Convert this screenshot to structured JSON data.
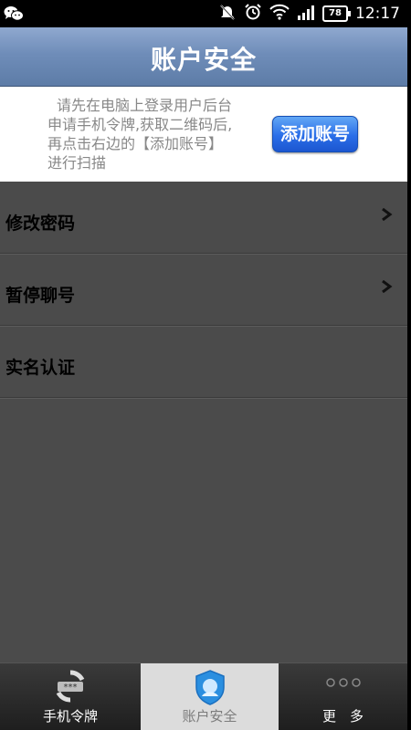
{
  "status": {
    "battery": "78",
    "time": "12:17"
  },
  "header": {
    "title": "账户安全"
  },
  "notice": {
    "line1": "请先在电脑上登录用户后台",
    "line2": "申请手机令牌,获取二维码后,",
    "line3": "再点击右边的【添加账号】",
    "line4": "进行扫描",
    "add_button": "添加账号"
  },
  "menu": {
    "items": [
      {
        "label": "修改密码",
        "chevron": true
      },
      {
        "label": "暂停聊号",
        "chevron": true
      },
      {
        "label": "实名认证",
        "chevron": false
      }
    ]
  },
  "tabs": [
    {
      "label": "手机令牌",
      "icon": "token-icon",
      "selected": false
    },
    {
      "label": "账户安全",
      "icon": "shield-icon",
      "selected": true
    },
    {
      "label": "更　多",
      "icon": "more-dots-icon",
      "selected": false
    }
  ],
  "colors": {
    "title_bar": "#6f8db9",
    "add_button": "#2a6ee8",
    "list_bg": "#4b4b4b",
    "selected_tab": "#dcdcdc"
  }
}
